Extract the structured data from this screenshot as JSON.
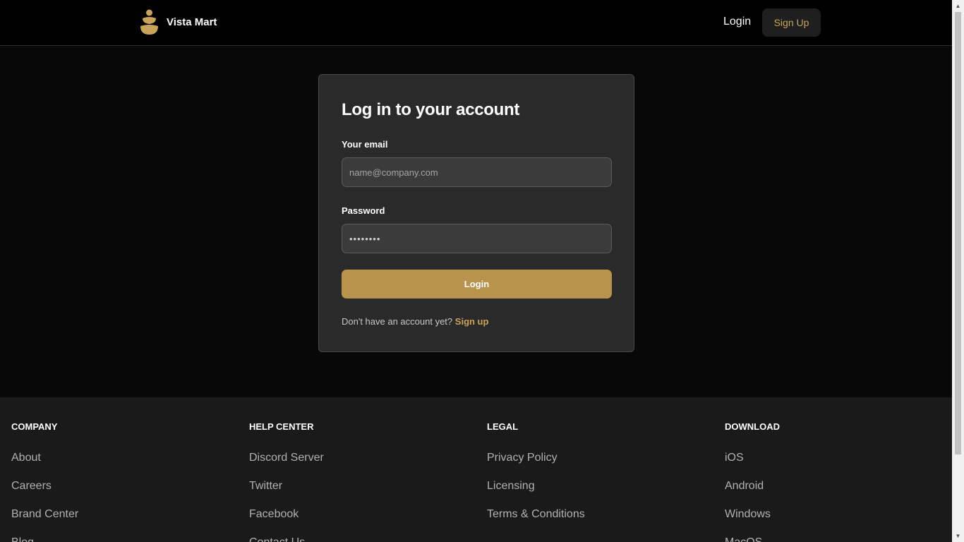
{
  "header": {
    "brand_name": "Vista Mart",
    "login_label": "Login",
    "signup_label": "Sign Up"
  },
  "login_card": {
    "title": "Log in to your account",
    "email_label": "Your email",
    "email_placeholder": "name@company.com",
    "password_label": "Password",
    "password_value": "••••••••",
    "submit_label": "Login",
    "no_account_text": "Don't have an account yet?",
    "signup_link": "Sign up"
  },
  "footer": {
    "columns": [
      {
        "heading": "COMPANY",
        "links": [
          "About",
          "Careers",
          "Brand Center",
          "Blog"
        ]
      },
      {
        "heading": "HELP CENTER",
        "links": [
          "Discord Server",
          "Twitter",
          "Facebook",
          "Contact Us"
        ]
      },
      {
        "heading": "LEGAL",
        "links": [
          "Privacy Policy",
          "Licensing",
          "Terms & Conditions"
        ]
      },
      {
        "heading": "DOWNLOAD",
        "links": [
          "iOS",
          "Android",
          "Windows",
          "MacOS"
        ]
      }
    ]
  },
  "colors": {
    "accent": "#b8934c",
    "accent_text": "#c9a35a",
    "background": "#080808",
    "card": "#2a2a2a",
    "footer": "#1a1a1a"
  }
}
